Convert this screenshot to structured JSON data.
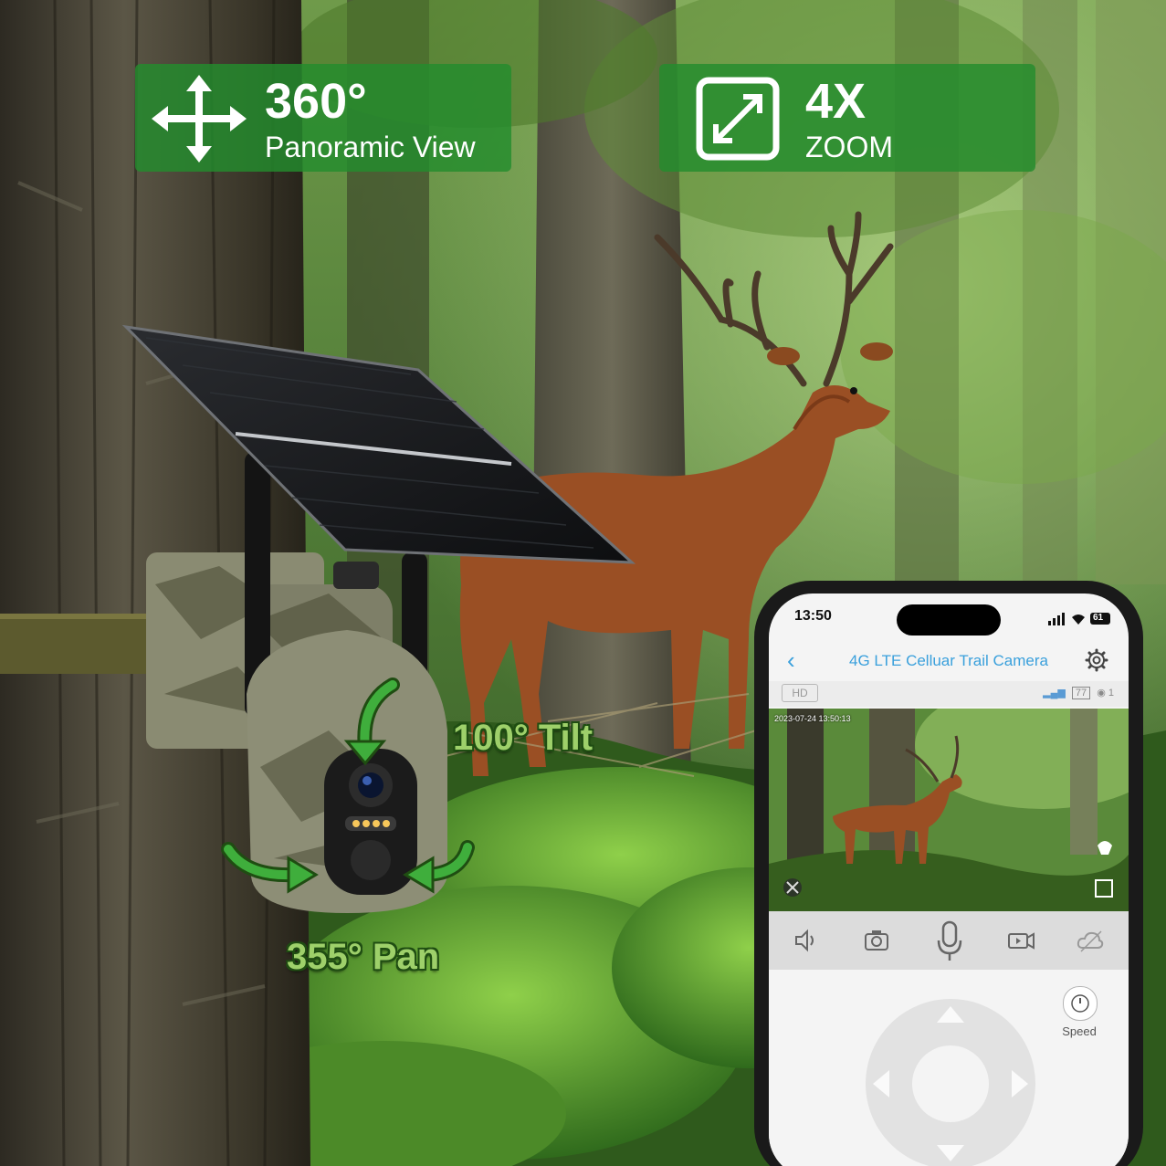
{
  "features": {
    "panoramic": {
      "value": "360°",
      "label": "Panoramic View"
    },
    "zoom": {
      "value": "4X",
      "label": "ZOOM"
    }
  },
  "callouts": {
    "tilt": "100° Tilt",
    "pan": "355° Pan"
  },
  "phone": {
    "status_time": "13:50",
    "battery": "61",
    "app_title": "4G LTE Celluar Trail Camera",
    "quality_badge": "HD",
    "signal_battery": "77",
    "viewer_count": "1",
    "timestamp": "2023-07-24 13:50:13",
    "speed_label": "Speed",
    "toolbar": [
      "speaker-icon",
      "snapshot-icon",
      "microphone-icon",
      "record-icon",
      "cloud-icon"
    ]
  },
  "colors": {
    "badge_green": "#238c2d",
    "callout_green": "#9ed06a",
    "app_blue": "#3aa0dc"
  }
}
